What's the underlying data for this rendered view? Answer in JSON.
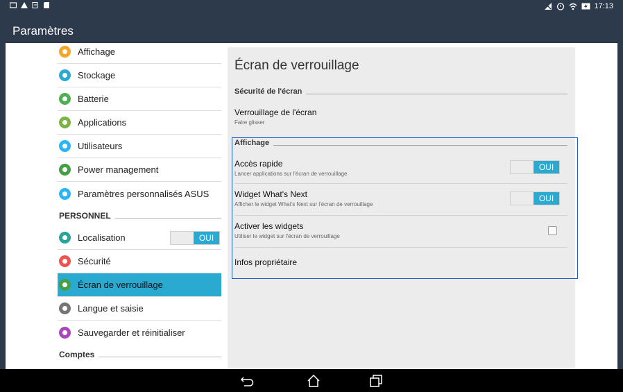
{
  "status_bar": {
    "left_icons": [
      "screenshot-icon",
      "warning-icon",
      "sim-icon",
      "sd-card-icon"
    ],
    "right_icons": [
      "no-signal-icon",
      "alarm-icon",
      "wifi-icon",
      "battery-charging-icon"
    ],
    "time": "17:13"
  },
  "action_bar": {
    "title": "Paramètres"
  },
  "sidebar": {
    "items": [
      {
        "label": "Affichage",
        "icon": "display-icon",
        "color": "#f5a623"
      },
      {
        "label": "Stockage",
        "icon": "storage-icon",
        "color": "#2aa9d1"
      },
      {
        "label": "Batterie",
        "icon": "battery-icon",
        "color": "#4caf50"
      },
      {
        "label": "Applications",
        "icon": "apps-icon",
        "color": "#7cb342"
      },
      {
        "label": "Utilisateurs",
        "icon": "users-icon",
        "color": "#29b6f6"
      },
      {
        "label": "Power management",
        "icon": "power-management-icon",
        "color": "#43a047"
      },
      {
        "label": "Paramètres personnalisés ASUS",
        "icon": "asus-settings-icon",
        "color": "#29b6f6"
      }
    ],
    "personnel_header": "PERSONNEL",
    "personnel_items": [
      {
        "label": "Localisation",
        "icon": "location-icon",
        "color": "#26a69a",
        "toggle": "OUI"
      },
      {
        "label": "Sécurité",
        "icon": "lock-icon",
        "color": "#ef5350"
      },
      {
        "label": "Écran de verrouillage",
        "icon": "lock-screen-icon",
        "color": "#43a047",
        "selected": true
      },
      {
        "label": "Langue et saisie",
        "icon": "language-icon",
        "color": "#757575"
      },
      {
        "label": "Sauvegarder et réinitialiser",
        "icon": "backup-icon",
        "color": "#ab47bc"
      }
    ],
    "comptes_header": "Comptes"
  },
  "main": {
    "title": "Écran de verrouillage",
    "section_security": "Sécurité de l'écran",
    "lock_title": "Verrouillage de l'écran",
    "lock_summary": "Faire glisser",
    "section_display": "Affichage",
    "quick_access_title": "Accès rapide",
    "quick_access_summary": "Lancer applications sur l'écran de verrouillage",
    "quick_access_toggle": "OUI",
    "whats_next_title": "Widget What's Next",
    "whats_next_summary": "Afficher le widget What's Next sur l'écran de verrouillage",
    "whats_next_toggle": "OUI",
    "widgets_title": "Activer les widgets",
    "widgets_summary": "Utiliser le widget sur l'écran de verrouillage",
    "widgets_checked": false,
    "owner_info_title": "Infos propriétaire"
  },
  "nav_bar": {
    "icons": [
      "back-icon",
      "home-icon",
      "recent-apps-icon"
    ]
  },
  "colors": {
    "accent": "#2aa9d1",
    "bar": "#2d3a4c",
    "highlight": "#1a5fbf"
  }
}
